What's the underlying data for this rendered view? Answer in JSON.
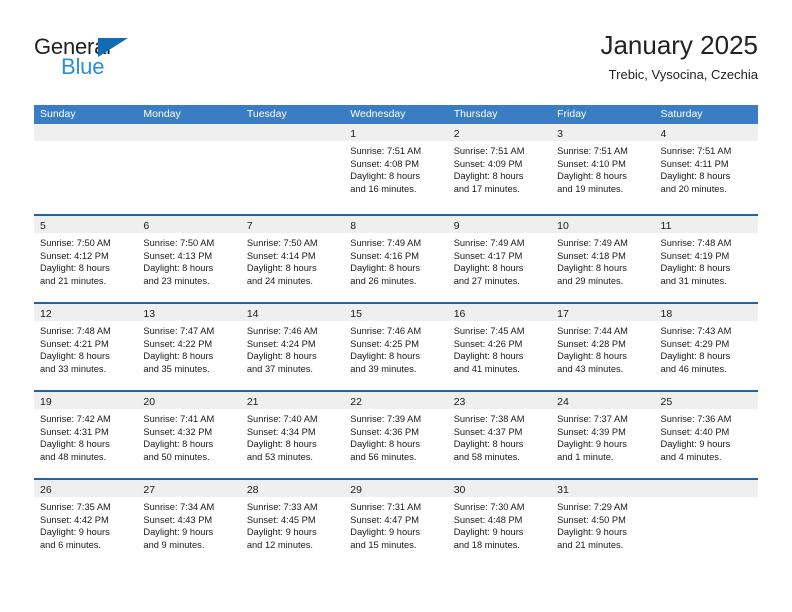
{
  "brand": {
    "name_top": "General",
    "name_bottom": "Blue",
    "triangle_color": "#0f6cb5",
    "blue_text_color": "#2d8fd5",
    "dark_text_color": "#231f20"
  },
  "header": {
    "title": "January 2025",
    "subtitle": "Trebic, Vysocina, Czechia"
  },
  "theme": {
    "header_bar_color": "#3b7dc4",
    "week_divider_color": "#1f62ad",
    "day_band_color": "#efefef",
    "text_color": "#1a1a1a"
  },
  "weekdays": [
    "Sunday",
    "Monday",
    "Tuesday",
    "Wednesday",
    "Thursday",
    "Friday",
    "Saturday"
  ],
  "weeks": [
    [
      {
        "day": "",
        "lines": []
      },
      {
        "day": "",
        "lines": []
      },
      {
        "day": "",
        "lines": []
      },
      {
        "day": "1",
        "lines": [
          "Sunrise: 7:51 AM",
          "Sunset: 4:08 PM",
          "Daylight: 8 hours",
          "and 16 minutes."
        ]
      },
      {
        "day": "2",
        "lines": [
          "Sunrise: 7:51 AM",
          "Sunset: 4:09 PM",
          "Daylight: 8 hours",
          "and 17 minutes."
        ]
      },
      {
        "day": "3",
        "lines": [
          "Sunrise: 7:51 AM",
          "Sunset: 4:10 PM",
          "Daylight: 8 hours",
          "and 19 minutes."
        ]
      },
      {
        "day": "4",
        "lines": [
          "Sunrise: 7:51 AM",
          "Sunset: 4:11 PM",
          "Daylight: 8 hours",
          "and 20 minutes."
        ]
      }
    ],
    [
      {
        "day": "5",
        "lines": [
          "Sunrise: 7:50 AM",
          "Sunset: 4:12 PM",
          "Daylight: 8 hours",
          "and 21 minutes."
        ]
      },
      {
        "day": "6",
        "lines": [
          "Sunrise: 7:50 AM",
          "Sunset: 4:13 PM",
          "Daylight: 8 hours",
          "and 23 minutes."
        ]
      },
      {
        "day": "7",
        "lines": [
          "Sunrise: 7:50 AM",
          "Sunset: 4:14 PM",
          "Daylight: 8 hours",
          "and 24 minutes."
        ]
      },
      {
        "day": "8",
        "lines": [
          "Sunrise: 7:49 AM",
          "Sunset: 4:16 PM",
          "Daylight: 8 hours",
          "and 26 minutes."
        ]
      },
      {
        "day": "9",
        "lines": [
          "Sunrise: 7:49 AM",
          "Sunset: 4:17 PM",
          "Daylight: 8 hours",
          "and 27 minutes."
        ]
      },
      {
        "day": "10",
        "lines": [
          "Sunrise: 7:49 AM",
          "Sunset: 4:18 PM",
          "Daylight: 8 hours",
          "and 29 minutes."
        ]
      },
      {
        "day": "11",
        "lines": [
          "Sunrise: 7:48 AM",
          "Sunset: 4:19 PM",
          "Daylight: 8 hours",
          "and 31 minutes."
        ]
      }
    ],
    [
      {
        "day": "12",
        "lines": [
          "Sunrise: 7:48 AM",
          "Sunset: 4:21 PM",
          "Daylight: 8 hours",
          "and 33 minutes."
        ]
      },
      {
        "day": "13",
        "lines": [
          "Sunrise: 7:47 AM",
          "Sunset: 4:22 PM",
          "Daylight: 8 hours",
          "and 35 minutes."
        ]
      },
      {
        "day": "14",
        "lines": [
          "Sunrise: 7:46 AM",
          "Sunset: 4:24 PM",
          "Daylight: 8 hours",
          "and 37 minutes."
        ]
      },
      {
        "day": "15",
        "lines": [
          "Sunrise: 7:46 AM",
          "Sunset: 4:25 PM",
          "Daylight: 8 hours",
          "and 39 minutes."
        ]
      },
      {
        "day": "16",
        "lines": [
          "Sunrise: 7:45 AM",
          "Sunset: 4:26 PM",
          "Daylight: 8 hours",
          "and 41 minutes."
        ]
      },
      {
        "day": "17",
        "lines": [
          "Sunrise: 7:44 AM",
          "Sunset: 4:28 PM",
          "Daylight: 8 hours",
          "and 43 minutes."
        ]
      },
      {
        "day": "18",
        "lines": [
          "Sunrise: 7:43 AM",
          "Sunset: 4:29 PM",
          "Daylight: 8 hours",
          "and 46 minutes."
        ]
      }
    ],
    [
      {
        "day": "19",
        "lines": [
          "Sunrise: 7:42 AM",
          "Sunset: 4:31 PM",
          "Daylight: 8 hours",
          "and 48 minutes."
        ]
      },
      {
        "day": "20",
        "lines": [
          "Sunrise: 7:41 AM",
          "Sunset: 4:32 PM",
          "Daylight: 8 hours",
          "and 50 minutes."
        ]
      },
      {
        "day": "21",
        "lines": [
          "Sunrise: 7:40 AM",
          "Sunset: 4:34 PM",
          "Daylight: 8 hours",
          "and 53 minutes."
        ]
      },
      {
        "day": "22",
        "lines": [
          "Sunrise: 7:39 AM",
          "Sunset: 4:36 PM",
          "Daylight: 8 hours",
          "and 56 minutes."
        ]
      },
      {
        "day": "23",
        "lines": [
          "Sunrise: 7:38 AM",
          "Sunset: 4:37 PM",
          "Daylight: 8 hours",
          "and 58 minutes."
        ]
      },
      {
        "day": "24",
        "lines": [
          "Sunrise: 7:37 AM",
          "Sunset: 4:39 PM",
          "Daylight: 9 hours",
          "and 1 minute."
        ]
      },
      {
        "day": "25",
        "lines": [
          "Sunrise: 7:36 AM",
          "Sunset: 4:40 PM",
          "Daylight: 9 hours",
          "and 4 minutes."
        ]
      }
    ],
    [
      {
        "day": "26",
        "lines": [
          "Sunrise: 7:35 AM",
          "Sunset: 4:42 PM",
          "Daylight: 9 hours",
          "and 6 minutes."
        ]
      },
      {
        "day": "27",
        "lines": [
          "Sunrise: 7:34 AM",
          "Sunset: 4:43 PM",
          "Daylight: 9 hours",
          "and 9 minutes."
        ]
      },
      {
        "day": "28",
        "lines": [
          "Sunrise: 7:33 AM",
          "Sunset: 4:45 PM",
          "Daylight: 9 hours",
          "and 12 minutes."
        ]
      },
      {
        "day": "29",
        "lines": [
          "Sunrise: 7:31 AM",
          "Sunset: 4:47 PM",
          "Daylight: 9 hours",
          "and 15 minutes."
        ]
      },
      {
        "day": "30",
        "lines": [
          "Sunrise: 7:30 AM",
          "Sunset: 4:48 PM",
          "Daylight: 9 hours",
          "and 18 minutes."
        ]
      },
      {
        "day": "31",
        "lines": [
          "Sunrise: 7:29 AM",
          "Sunset: 4:50 PM",
          "Daylight: 9 hours",
          "and 21 minutes."
        ]
      },
      {
        "day": "",
        "lines": []
      }
    ]
  ]
}
